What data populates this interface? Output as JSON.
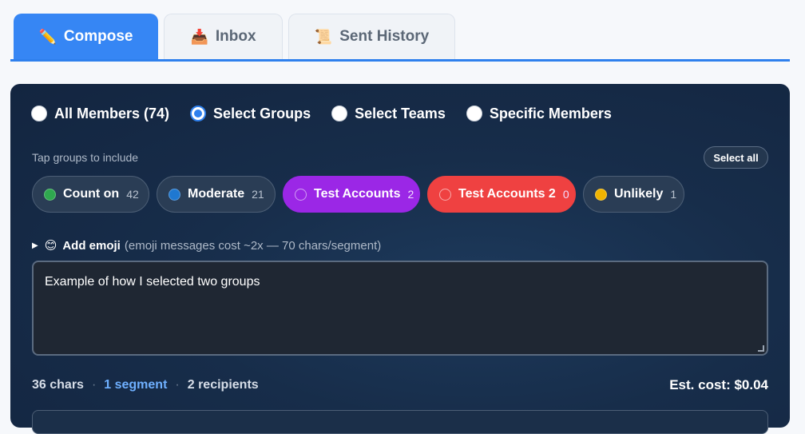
{
  "tabs": [
    {
      "label": "Compose",
      "icon": "pencil-icon",
      "glyph": "✏️",
      "active": true
    },
    {
      "label": "Inbox",
      "icon": "inbox-tray-icon",
      "glyph": "📥",
      "active": false
    },
    {
      "label": "Sent History",
      "icon": "scroll-icon",
      "glyph": "📜",
      "active": false
    }
  ],
  "recipient_mode": {
    "options": [
      {
        "label": "All Members (74)",
        "checked": false
      },
      {
        "label": "Select Groups",
        "checked": true
      },
      {
        "label": "Select Teams",
        "checked": false
      },
      {
        "label": "Specific Members",
        "checked": false
      }
    ]
  },
  "groups": {
    "hint": "Tap groups to include",
    "select_all_label": "Select all",
    "chips": [
      {
        "label": "Count on",
        "count": "42",
        "color": "#2fa84f",
        "selected": false
      },
      {
        "label": "Moderate",
        "count": "21",
        "color": "#1f78d1",
        "selected": false
      },
      {
        "label": "Test Accounts",
        "count": "2",
        "color": "#9b27e6",
        "selected": true
      },
      {
        "label": "Test Accounts 2",
        "count": "0",
        "color": "#ef4141",
        "selected": true
      },
      {
        "label": "Unlikely",
        "count": "1",
        "color": "#f0b400",
        "selected": false
      }
    ]
  },
  "emoji": {
    "toggle_glyph": "▶",
    "glyph": "😊",
    "label": "Add emoji",
    "note": "(emoji messages cost ~2x — 70 chars/segment)"
  },
  "message": {
    "value": "Example of how I selected two groups"
  },
  "stats": {
    "chars": "36 chars",
    "separator": "·",
    "segments": "1 segment",
    "recipients": "2 recipients",
    "cost": "Est. cost: $0.04"
  }
}
